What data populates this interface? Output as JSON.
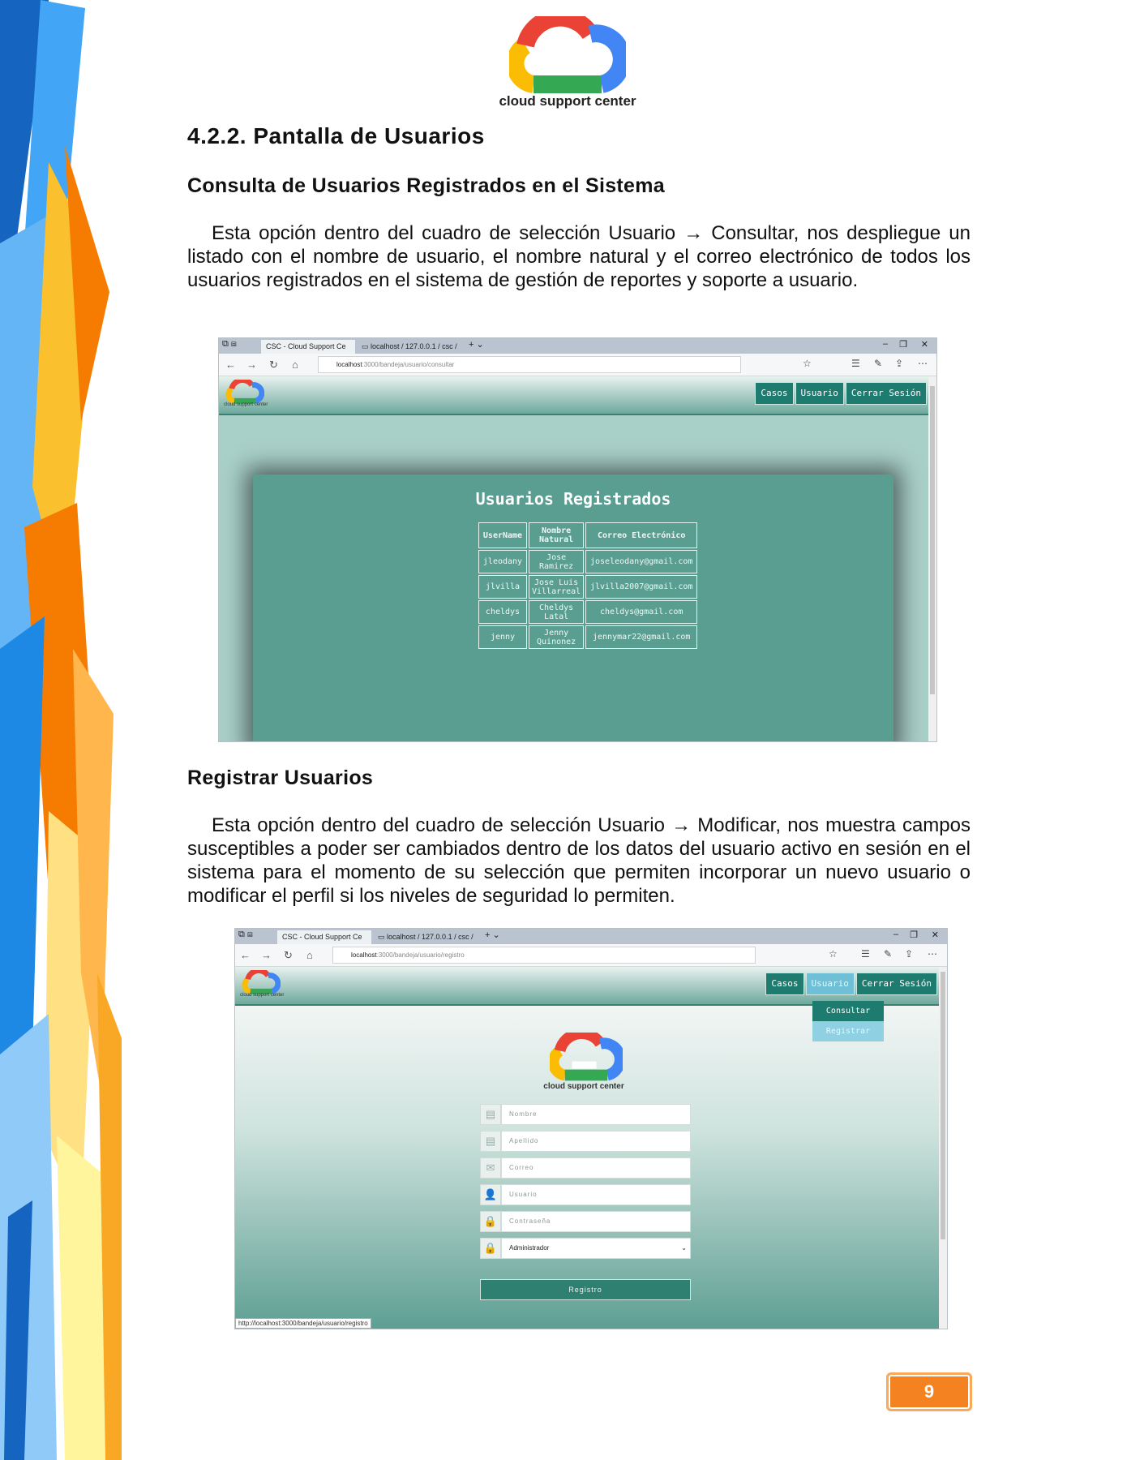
{
  "header": {
    "logo_text": "cloud support center",
    "section_title": "4.2.2.  Pantalla de Usuarios"
  },
  "consulta": {
    "heading": "Consulta de Usuarios Registrados en el Sistema",
    "paragraph": "Esta opción dentro del cuadro de selección Usuario → Consultar, nos despliegue un listado con el nombre de usuario, el nombre natural y el correo electrónico de todos los usuarios registrados en el sistema de gestión de reportes y soporte a usuario."
  },
  "browser1": {
    "tab1": "CSC - Cloud Support Ce",
    "tab2": "localhost / 127.0.0.1 / csc /",
    "url_host": "localhost",
    "url_path": ":3000/bandeja/usuario/consultar",
    "logo_text": "cloud support center",
    "menu": [
      "Casos",
      "Usuario",
      "Cerrar Sesión"
    ],
    "card_title": "Usuarios Registrados",
    "table_headers": [
      "UserName",
      "Nombre Natural",
      "Correo Electrónico"
    ],
    "rows": [
      [
        "jleodany",
        "Jose Ramirez",
        "joseleodany@gmail.com"
      ],
      [
        "jlvilla",
        "Jose Luis Villarreal",
        "jlvilla2007@gmail.com"
      ],
      [
        "cheldys",
        "Cheldys Latal",
        "cheldys@gmail.com"
      ],
      [
        "jenny",
        "Jenny Quinonez",
        "jennymar22@gmail.com"
      ]
    ]
  },
  "registrar": {
    "heading": "Registrar Usuarios",
    "paragraph": "Esta opción dentro del cuadro de selección Usuario → Modificar, nos muestra campos susceptibles a poder ser cambiados dentro de los datos del usuario activo en sesión en el sistema para el momento de su selección que permiten incorporar un nuevo usuario o modificar el perfil si los niveles de seguridad lo permiten."
  },
  "browser2": {
    "tab1": "CSC - Cloud Support Ce",
    "tab2": "localhost / 127.0.0.1 / csc /",
    "url_host": "localhost",
    "url_path": ":3000/bandeja/usuario/registro",
    "logo_text": "cloud support center",
    "menu": [
      "Casos",
      "Usuario",
      "Cerrar Sesión"
    ],
    "dropdown": [
      "Consultar",
      "Registrar"
    ],
    "form_logo_text": "cloud support center",
    "fields": [
      "Nombre",
      "Apellido",
      "Correo",
      "Usuario",
      "Contraseña"
    ],
    "select_value": "Administrador",
    "button": "Registro",
    "status_url": "http://localhost:3000/bandeja/usuario/registro"
  },
  "page_number": "9"
}
